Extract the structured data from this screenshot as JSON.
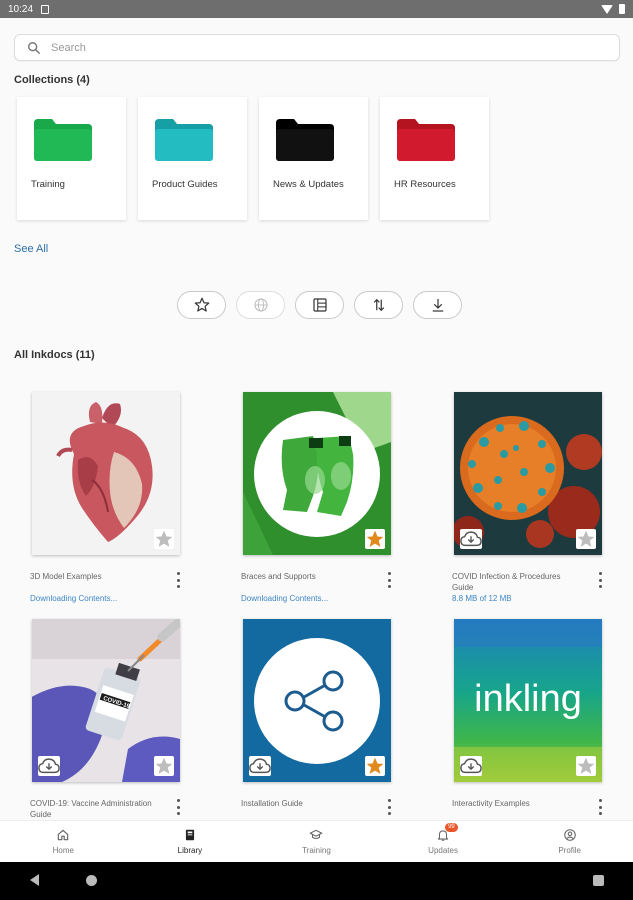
{
  "status_bar": {
    "time": "10:24"
  },
  "search": {
    "placeholder": "Search",
    "value": ""
  },
  "collections": {
    "title": "Collections (4)",
    "see_all": "See All",
    "items": [
      {
        "label": "Training",
        "color": "#19a84a"
      },
      {
        "label": "Product Guides",
        "color": "#1fb3b8"
      },
      {
        "label": "News & Updates",
        "color": "#111111"
      },
      {
        "label": "HR Resources",
        "color": "#d21a2e"
      }
    ]
  },
  "toolbar": {
    "buttons": [
      {
        "name": "favorites-filter-button",
        "icon": "star-outline-icon"
      },
      {
        "name": "globe-button",
        "icon": "globe-icon"
      },
      {
        "name": "view-toggle-button",
        "icon": "table-view-icon"
      },
      {
        "name": "sort-button",
        "icon": "sort-arrows-icon"
      },
      {
        "name": "download-button",
        "icon": "download-icon"
      }
    ]
  },
  "inkdocs": {
    "title": "All Inkdocs (11)",
    "items": [
      {
        "title": "3D Model Examples",
        "status": "Downloading Contents...",
        "starred": false,
        "icon": "heart-anatomy-image"
      },
      {
        "title": "Braces and Supports",
        "status": "Downloading Contents...",
        "starred": true,
        "icon": "knee-brace-image"
      },
      {
        "title": "COVID Infection & Procedures Guide",
        "status": "8.8 MB of 12 MB",
        "starred": false,
        "icon": "virus-image"
      },
      {
        "title": "COVID-19: Vaccine Administration Guide",
        "status": "",
        "starred": false,
        "icon": "vaccine-image"
      },
      {
        "title": "Installation Guide",
        "status": "",
        "starred": true,
        "icon": "share-network-image"
      },
      {
        "title": "Interactivity Examples",
        "status": "",
        "starred": false,
        "icon": "inkling-logo-image"
      }
    ],
    "inkling_logo_text": "inkling",
    "vaccine_label": "COVID-19"
  },
  "colors": {
    "accent_link": "#2f6fa8",
    "star_active": "#e08a1e",
    "badge": "#e8562a"
  },
  "bottom_nav": {
    "items": [
      {
        "label": "Home",
        "icon": "home-icon"
      },
      {
        "label": "Library",
        "icon": "library-icon"
      },
      {
        "label": "Training",
        "icon": "graduation-cap-icon"
      },
      {
        "label": "Updates",
        "icon": "bell-icon",
        "badge": "99"
      },
      {
        "label": "Profile",
        "icon": "profile-icon"
      }
    ]
  }
}
